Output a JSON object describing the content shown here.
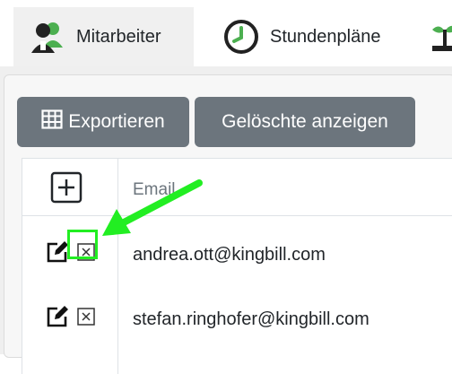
{
  "tabs": [
    {
      "label": "Mitarbeiter",
      "icon": "team-icon",
      "active": true
    },
    {
      "label": "Stundenpläne",
      "icon": "clock-icon",
      "active": false
    },
    {
      "label": "",
      "icon": "plant-icon",
      "active": false
    }
  ],
  "toolbar": {
    "export_label": "Exportieren",
    "export_icon": "table-icon",
    "show_deleted_label": "Gelöschte anzeigen"
  },
  "table": {
    "add_icon": "plus-square-icon",
    "header_email": "Email",
    "rows": [
      {
        "email": "andrea.ott@kingbill.com",
        "edit_icon": "edit-icon",
        "delete_icon": "delete-box-icon",
        "highlighted": true
      },
      {
        "email": "stefan.ringhofer@kingbill.com",
        "edit_icon": "edit-icon",
        "delete_icon": "delete-box-icon",
        "highlighted": false
      }
    ]
  },
  "colors": {
    "button_bg": "#6c757d",
    "annotation": "#22ee22",
    "tab_active_bg": "#f0f0f0"
  }
}
